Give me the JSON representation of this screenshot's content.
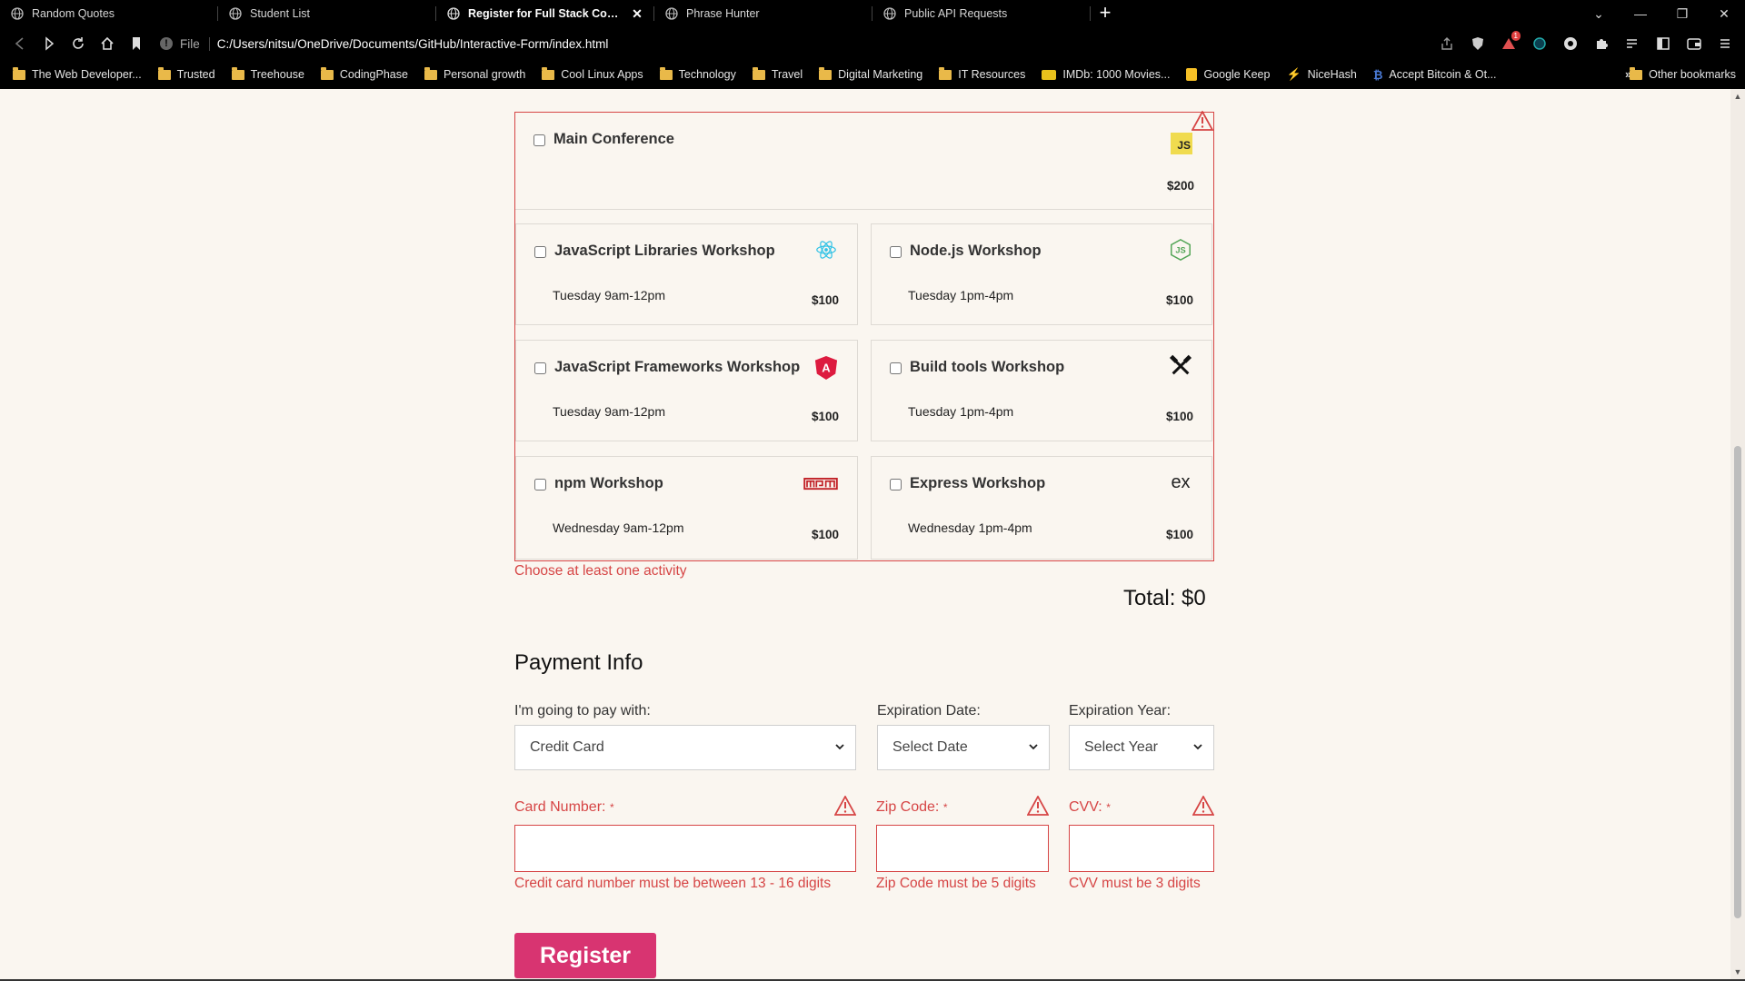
{
  "browser": {
    "tabs": [
      {
        "title": "Random Quotes",
        "active": false
      },
      {
        "title": "Student List",
        "active": false
      },
      {
        "title": "Register for Full Stack Conference",
        "active": true
      },
      {
        "title": "Phrase Hunter",
        "active": false
      },
      {
        "title": "Public API Requests",
        "active": false
      }
    ],
    "new_tab_icon": "plus-icon",
    "omnibox": {
      "scheme_label": "File",
      "url": "C:/Users/nitsu/OneDrive/Documents/GitHub/Interactive-Form/index.html"
    },
    "notification_count": "1",
    "bookmarks": [
      "The Web Developer...",
      "Trusted",
      "Treehouse",
      "CodingPhase",
      "Personal growth",
      "Cool Linux Apps",
      "Technology",
      "Travel",
      "Digital Marketing",
      "IT Resources",
      "IMDb: 1000 Movies...",
      "Google Keep",
      "NiceHash",
      "Accept Bitcoin & Ot..."
    ],
    "bookmarks_more": "»",
    "other_bookmarks": "Other bookmarks"
  },
  "activities": {
    "main": {
      "title": "Main Conference",
      "price": "$200",
      "icon": "js-icon"
    },
    "workshops": [
      {
        "title": "JavaScript Libraries Workshop",
        "time": "Tuesday 9am-12pm",
        "price": "$100",
        "icon": "react-icon"
      },
      {
        "title": "Node.js Workshop",
        "time": "Tuesday 1pm-4pm",
        "price": "$100",
        "icon": "nodejs-icon"
      },
      {
        "title": "JavaScript Frameworks Workshop",
        "time": "Tuesday 9am-12pm",
        "price": "$100",
        "icon": "angular-icon"
      },
      {
        "title": "Build tools Workshop",
        "time": "Tuesday 1pm-4pm",
        "price": "$100",
        "icon": "tools-icon"
      },
      {
        "title": "npm Workshop",
        "time": "Wednesday 9am-12pm",
        "price": "$100",
        "icon": "npm-icon"
      },
      {
        "title": "Express Workshop",
        "time": "Wednesday 1pm-4pm",
        "price": "$100",
        "icon": "express-icon"
      }
    ],
    "error": "Choose at least one activity",
    "total": "Total: $0"
  },
  "payment": {
    "title": "Payment Info",
    "method_label": "I'm going to pay with:",
    "method_value": "Credit Card",
    "exp_date_label": "Expiration Date:",
    "exp_date_value": "Select Date",
    "exp_year_label": "Expiration Year:",
    "exp_year_value": "Select Year",
    "card_label": "Card Number:",
    "zip_label": "Zip Code:",
    "cvv_label": "CVV:",
    "required_mark": "*",
    "card_error": "Credit card number must be between 13 - 16 digits",
    "zip_error": "Zip Code must be 5 digits",
    "cvv_error": "CVV must be 3 digits",
    "register_label": "Register"
  },
  "colors": {
    "error": "#d64545",
    "register_button": "#d83471",
    "page_background": "#faf6f0"
  }
}
